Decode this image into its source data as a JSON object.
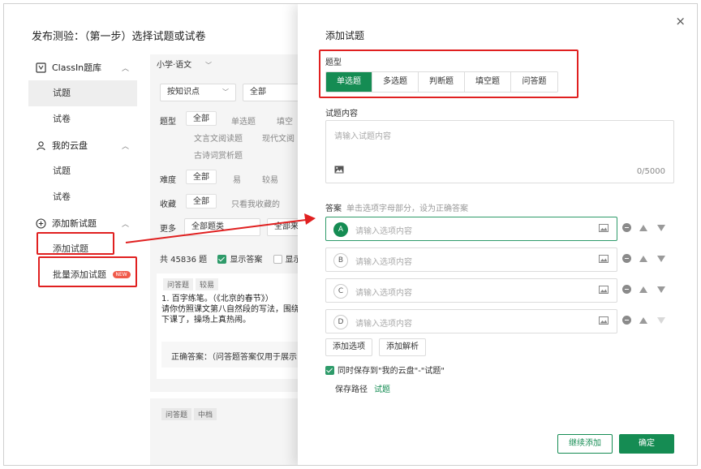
{
  "page": {
    "title": "发布测验：（第一步）选择试题或试卷"
  },
  "sidebar": {
    "groups": [
      {
        "label": "ClassIn题库",
        "icon": "library-icon",
        "items": [
          "试题",
          "试卷"
        ]
      },
      {
        "label": "我的云盘",
        "icon": "cloud-drive-icon",
        "items": [
          "试题",
          "试卷"
        ]
      },
      {
        "label": "添加新试题",
        "icon": "add-circle-icon",
        "items": [
          "添加试题",
          "批量添加试题"
        ]
      }
    ],
    "new_badge": "NEW"
  },
  "filters": {
    "subject": "小学·语文",
    "by_knowledge": "按知识点",
    "all_select": "全部",
    "type_label": "题型",
    "type_all": "全部",
    "type_options": [
      "单选题",
      "填空",
      "文言文阅读题",
      "现代文阅",
      "古诗词赏析题"
    ],
    "difficulty_label": "难度",
    "difficulty_all": "全部",
    "difficulty_options": [
      "易",
      "较易"
    ],
    "favorite_label": "收藏",
    "favorite_all": "全部",
    "favorite_only": "只看我收藏的",
    "more_label": "更多",
    "more_select": "全部题类",
    "more_select2": "全部来"
  },
  "results": {
    "count": "共 45836 题",
    "show_answer": "显示答案",
    "show_other": "显示"
  },
  "question_card": {
    "tags": [
      "问答题",
      "较易"
    ],
    "text_lines": [
      "1. 百字练笔。（《北京的春节》）",
      "请你仿照课文第八自然段的写法，围绕",
      "下课了，操场上真热闹。"
    ],
    "answer": "正确答案：（问答题答案仅用于展示"
  },
  "question_card2": {
    "tags": [
      "问答题",
      "中档"
    ]
  },
  "dialog": {
    "title": "添加试题",
    "close": "×",
    "type_label": "题型",
    "types": [
      "单选题",
      "多选题",
      "判断题",
      "填空题",
      "问答题"
    ],
    "active_type_index": 0,
    "content_label": "试题内容",
    "content_placeholder": "请输入试题内容",
    "content_counter": "0/5000",
    "answer_label": "答案",
    "answer_hint": "单击选项字母部分，设为正确答案",
    "options": [
      {
        "letter": "A",
        "placeholder": "请输入选项内容"
      },
      {
        "letter": "B",
        "placeholder": "请输入选项内容"
      },
      {
        "letter": "C",
        "placeholder": "请输入选项内容"
      },
      {
        "letter": "D",
        "placeholder": "请输入选项内容"
      }
    ],
    "add_option": "添加选项",
    "add_analysis": "添加解析",
    "save_to_cloud": "同时保存到\"我的云盘\"-\"试题\"",
    "save_path_label": "保存路径",
    "save_path_value": "试题",
    "continue_button": "继续添加",
    "confirm_button": "确定"
  },
  "colors": {
    "primary": "#158c53",
    "highlight": "#e02020",
    "badge": "#f05a4a"
  }
}
